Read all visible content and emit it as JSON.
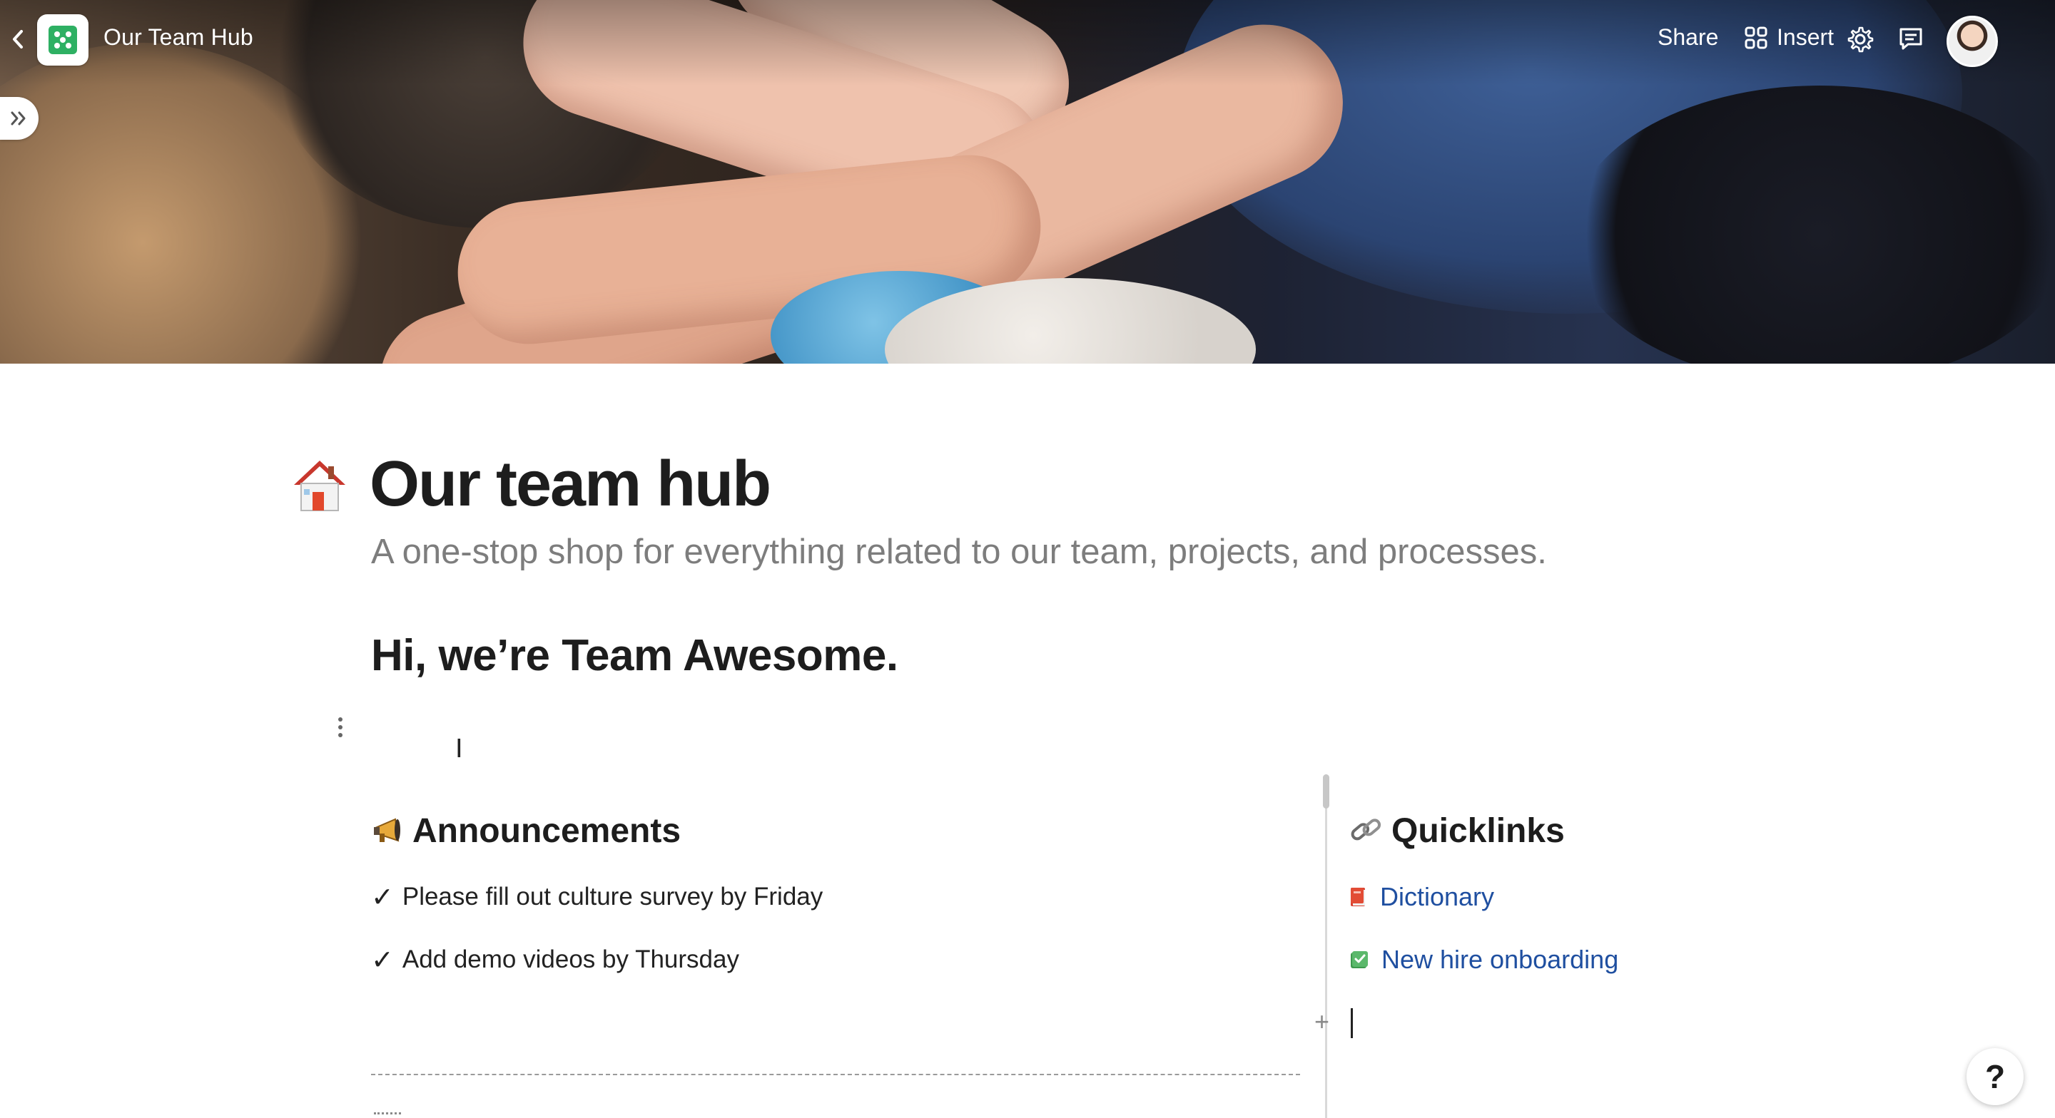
{
  "header": {
    "back_icon": "chevron-left-icon",
    "doc_icon": "grid-app-icon",
    "doc_title": "Our Team Hub",
    "share_label": "Share",
    "insert_label": "Insert",
    "insert_icon": "grid-four-icon",
    "settings_icon": "gear-icon",
    "comments_icon": "comment-icon",
    "avatar_icon": "user-avatar"
  },
  "sidebar": {
    "expand_icon": "double-chevron-right-icon"
  },
  "page": {
    "emoji": "house-icon",
    "title": "Our team hub",
    "subtitle": "A one-stop shop for everything related to our team, projects, and processes.",
    "heading": "Hi, we’re Team Awesome."
  },
  "announcements": {
    "icon": "megaphone-icon",
    "title": "Announcements",
    "items": [
      {
        "check": "✓",
        "text": "Please fill out culture survey by Friday"
      },
      {
        "check": "✓",
        "text": "Add demo videos by Thursday"
      }
    ]
  },
  "quicklinks": {
    "icon": "link-icon",
    "title": "Quicklinks",
    "items": [
      {
        "icon": "book-icon",
        "text": "Dictionary"
      },
      {
        "icon": "checkbox-icon",
        "text": "New hire onboarding"
      }
    ]
  },
  "controls": {
    "plus_label": "+",
    "help_label": "?"
  },
  "colors": {
    "link": "#1f4fa0",
    "subtitle": "#7d7d7d",
    "accent_green": "#2eb063"
  }
}
